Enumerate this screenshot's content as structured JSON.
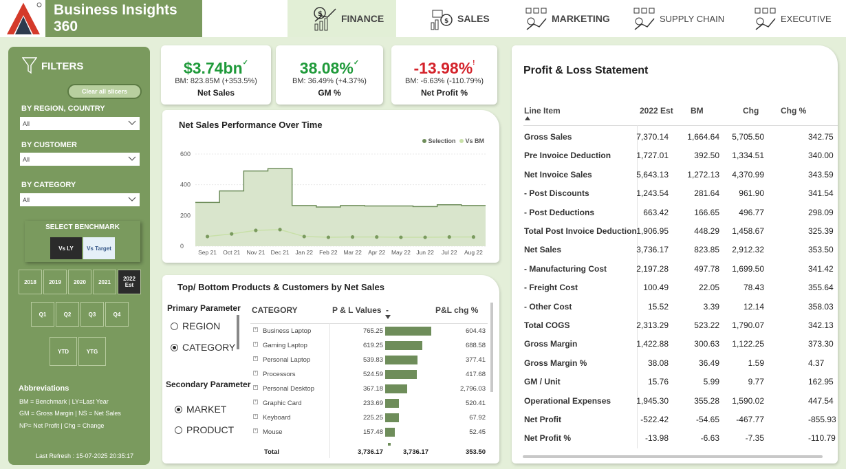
{
  "brand": {
    "title": "Business Insights 360"
  },
  "nav": [
    {
      "label": "FINANCE",
      "icon": "finance-icon"
    },
    {
      "label": "SALES",
      "icon": "sales-icon"
    },
    {
      "label": "MARKETING",
      "icon": "marketing-icon"
    },
    {
      "label": "SUPPLY CHAIN",
      "icon": "supply-chain-icon"
    },
    {
      "label": "EXECUTIVE",
      "icon": "executive-icon"
    }
  ],
  "filters": {
    "title": "FILTERS",
    "clear_label": "Clear all slicers",
    "region_label": "BY REGION, COUNTRY",
    "region_value": "All",
    "customer_label": "BY CUSTOMER",
    "customer_value": "All",
    "category_label": "BY CATEGORY",
    "category_value": "All",
    "benchmark_label": "SELECT BENCHMARK",
    "bench_ly": "Vs LY",
    "bench_target": "Vs Target",
    "years": [
      "2018",
      "2019",
      "2020",
      "2021",
      "2022 Est"
    ],
    "quarters": [
      "Q1",
      "Q2",
      "Q3",
      "Q4"
    ],
    "periods": [
      "YTD",
      "YTG"
    ],
    "abbr_title": "Abbreviations",
    "abbr": [
      "BM = Benchmark | LY=Last Year",
      "GM = Gross Margin | NS = Net Sales",
      "NP= Net Profit | Chg = Change"
    ],
    "refresh": "Last Refresh : 15-07-2025 20:35:17"
  },
  "kpis": [
    {
      "value": "$3.74bn",
      "mark": "✓",
      "bm": "BM: 823.85M (+353.5%)",
      "label": "Net Sales",
      "color": "#1f9a3a"
    },
    {
      "value": "38.08%",
      "mark": "✓",
      "bm": "BM: 36.49% (+4.37%)",
      "label": "GM %",
      "color": "#1f9a3a"
    },
    {
      "value": "-13.98%",
      "mark": "!",
      "bm": "BM: -6.63% (-110.79%)",
      "label": "Net Profit %",
      "color": "#d4232b"
    }
  ],
  "perf_chart": {
    "title": "Net Sales Performance Over Time",
    "legend": [
      "Selection",
      "Vs BM"
    ]
  },
  "chart_data": {
    "type": "area",
    "categories": [
      "Sep 21",
      "Oct 21",
      "Nov 21",
      "Dec 21",
      "Jan 22",
      "Feb 22",
      "Mar 22",
      "Apr 22",
      "May 22",
      "Jun 22",
      "Jul 22",
      "Aug 22"
    ],
    "yticks": [
      "0",
      "200",
      "400",
      "600"
    ],
    "ylim": [
      0,
      600
    ],
    "series": [
      {
        "name": "Selection",
        "values": [
          285,
          360,
          490,
          505,
          265,
          255,
          265,
          262,
          262,
          258,
          270,
          265
        ]
      },
      {
        "name": "Vs BM",
        "values": [
          63,
          80,
          103,
          108,
          63,
          58,
          60,
          60,
          58,
          58,
          60,
          60
        ]
      }
    ],
    "colors": {
      "selection": "#6e8d5a",
      "bm": "#c8e0a8"
    }
  },
  "top_bottom": {
    "title": "Top/ Bottom Products & Customers by Net Sales",
    "primary_label": "Primary Parameter",
    "primary_options": [
      "REGION",
      "CATEGORY"
    ],
    "secondary_label": "Secondary Parameter",
    "secondary_options": [
      "MARKET",
      "PRODUCT"
    ],
    "headers": {
      "category": "CATEGORY",
      "pl": "P & L Values",
      "sort": "-",
      "chg": "P&L chg %"
    },
    "rows": [
      {
        "category": "Business Laptop",
        "pl": "765.25",
        "value": 765.25,
        "chg": "604.43"
      },
      {
        "category": "Gaming Laptop",
        "pl": "619.25",
        "value": 619.25,
        "chg": "688.58"
      },
      {
        "category": "Personal Laptop",
        "pl": "539.83",
        "value": 539.83,
        "chg": "377.41"
      },
      {
        "category": "Processors",
        "pl": "524.59",
        "value": 524.59,
        "chg": "417.68"
      },
      {
        "category": "Personal Desktop",
        "pl": "367.18",
        "value": 367.18,
        "chg": "2,796.03"
      },
      {
        "category": "Graphic Card",
        "pl": "233.69",
        "value": 233.69,
        "chg": "520.41"
      },
      {
        "category": "Keyboard",
        "pl": "225.25",
        "value": 225.25,
        "chg": "67.92"
      },
      {
        "category": "Mouse",
        "pl": "157.48",
        "value": 157.48,
        "chg": "52.45"
      }
    ],
    "total": {
      "label": "Total",
      "pl": "3,736.17",
      "bar": "3,736.17",
      "chg": "353.50"
    }
  },
  "pnl": {
    "title": "Profit & Loss Statement",
    "headers": [
      "Line Item",
      "2022 Est",
      "BM",
      "Chg",
      "Chg %"
    ],
    "rows": [
      {
        "item": "Gross Sales",
        "est": "7,370.14",
        "bm": "1,664.64",
        "chg": "5,705.50",
        "pct": "342.75"
      },
      {
        "item": "Pre Invoice Deduction",
        "est": "1,727.01",
        "bm": "392.50",
        "chg": "1,334.51",
        "pct": "340.00"
      },
      {
        "item": "Net Invoice Sales",
        "est": "5,643.13",
        "bm": "1,272.13",
        "chg": "4,370.99",
        "pct": "343.59"
      },
      {
        "item": " - Post Discounts",
        "est": "1,243.54",
        "bm": "281.64",
        "chg": "961.90",
        "pct": "341.54"
      },
      {
        "item": " - Post Deductions",
        "est": "663.42",
        "bm": "166.65",
        "chg": "496.77",
        "pct": "298.09"
      },
      {
        "item": "Total Post Invoice Deduction",
        "est": "1,906.95",
        "bm": "448.29",
        "chg": "1,458.67",
        "pct": "325.39"
      },
      {
        "item": "Net Sales",
        "est": "3,736.17",
        "bm": "823.85",
        "chg": "2,912.32",
        "pct": "353.50"
      },
      {
        "item": " - Manufacturing Cost",
        "est": "2,197.28",
        "bm": "497.78",
        "chg": "1,699.50",
        "pct": "341.42"
      },
      {
        "item": " - Freight Cost",
        "est": "100.49",
        "bm": "22.05",
        "chg": "78.43",
        "pct": "355.64"
      },
      {
        "item": " - Other Cost",
        "est": "15.52",
        "bm": "3.39",
        "chg": "12.14",
        "pct": "358.03"
      },
      {
        "item": "Total COGS",
        "est": "2,313.29",
        "bm": "523.22",
        "chg": "1,790.07",
        "pct": "342.13"
      },
      {
        "item": "Gross Margin",
        "est": "1,422.88",
        "bm": "300.63",
        "chg": "1,122.25",
        "pct": "373.30"
      },
      {
        "item": "Gross Margin %",
        "est": "38.08",
        "bm": "36.49",
        "chg": "1.59",
        "pct": "4.37"
      },
      {
        "item": "GM / Unit",
        "est": "15.76",
        "bm": "5.99",
        "chg": "9.77",
        "pct": "162.95"
      },
      {
        "item": "Operational Expenses",
        "est": "1,945.30",
        "bm": "355.28",
        "chg": "1,590.02",
        "pct": "447.54"
      },
      {
        "item": "Net Profit",
        "est": "-522.42",
        "bm": "-54.65",
        "chg": "-467.77",
        "pct": "-855.93"
      },
      {
        "item": "Net Profit %",
        "est": "-13.98",
        "bm": "-6.63",
        "chg": "-7.35",
        "pct": "-110.79"
      }
    ]
  }
}
